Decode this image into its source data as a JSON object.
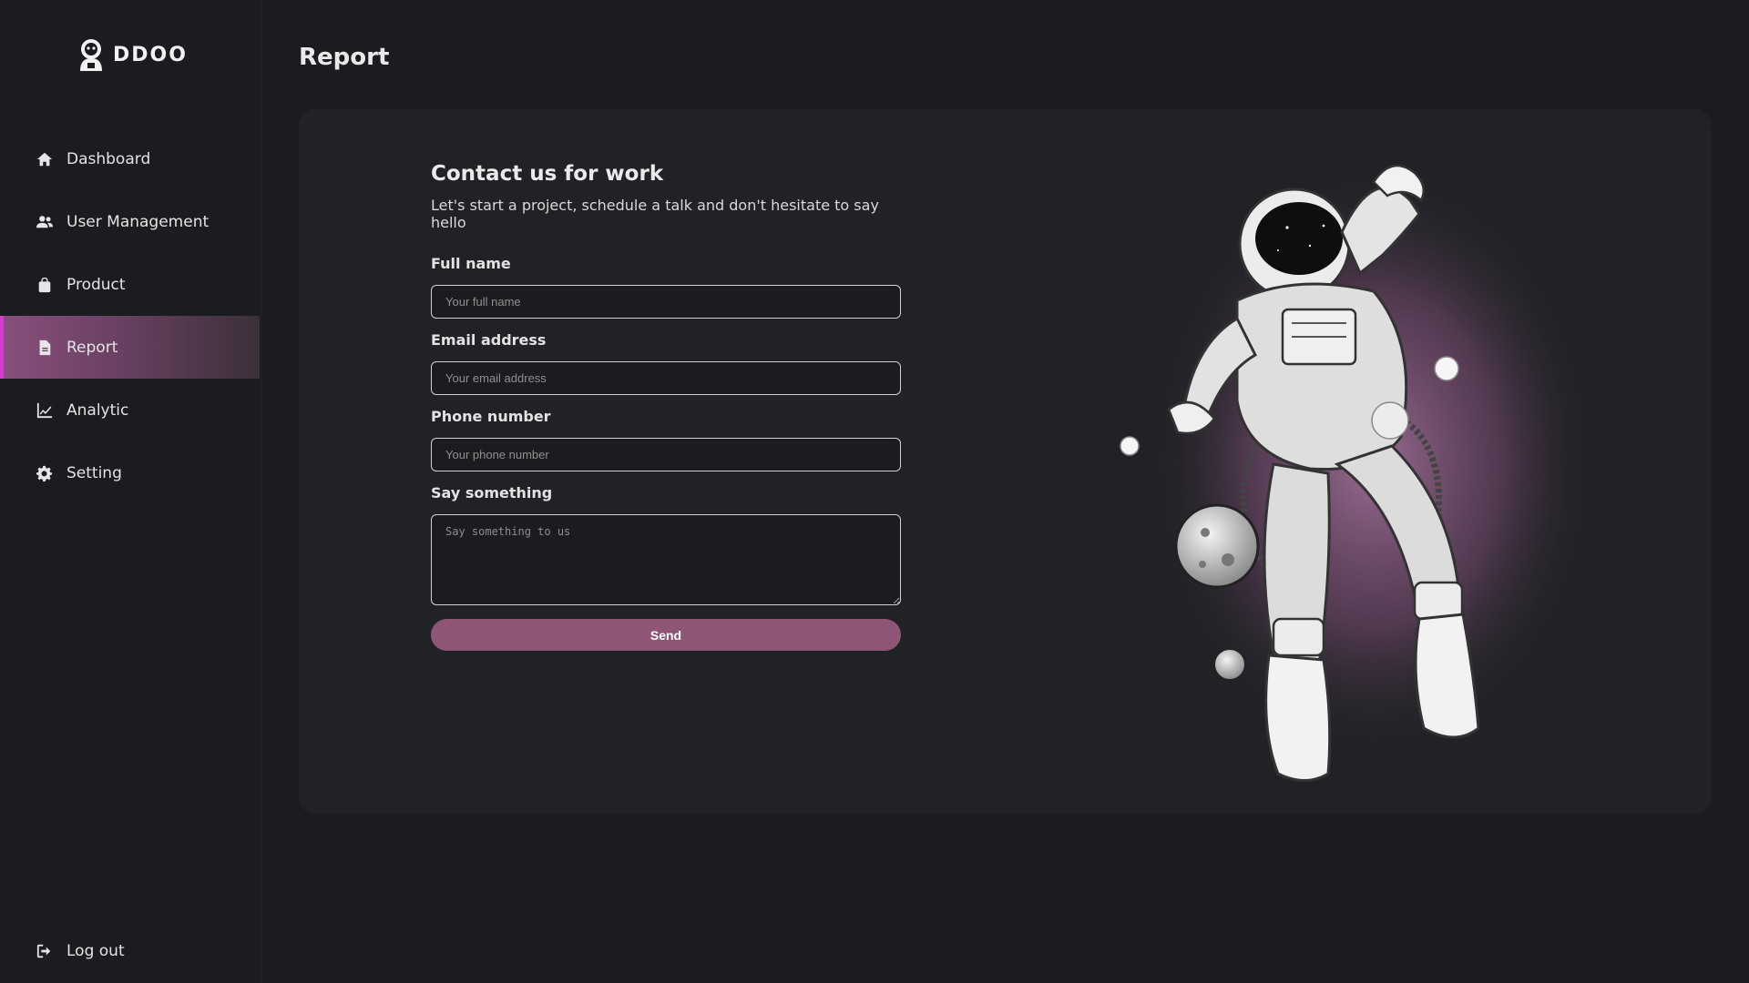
{
  "brand": {
    "name": "DDOO",
    "logo_icon": "astronaut-logo-icon"
  },
  "sidebar": {
    "items": [
      {
        "label": "Dashboard",
        "icon": "home-icon",
        "active": false
      },
      {
        "label": "User Management",
        "icon": "users-icon",
        "active": false
      },
      {
        "label": "Product",
        "icon": "bag-icon",
        "active": false
      },
      {
        "label": "Report",
        "icon": "file-icon",
        "active": true
      },
      {
        "label": "Analytic",
        "icon": "chart-line-icon",
        "active": false
      },
      {
        "label": "Setting",
        "icon": "gear-icon",
        "active": false
      }
    ],
    "logout": {
      "label": "Log out",
      "icon": "logout-icon"
    },
    "active_color": "#d63bd0"
  },
  "page": {
    "title": "Report"
  },
  "form": {
    "heading": "Contact us for work",
    "subheading": "Let's start a project, schedule a talk and don't hesitate to say hello",
    "full_name": {
      "label": "Full name",
      "placeholder": "Your full name",
      "value": ""
    },
    "email": {
      "label": "Email address",
      "placeholder": "Your email address",
      "value": ""
    },
    "phone": {
      "label": "Phone number",
      "placeholder": "Your phone number",
      "value": ""
    },
    "message": {
      "label": "Say something",
      "placeholder": "Say something to us",
      "value": ""
    },
    "send_label": "Send",
    "send_color": "#8f5577"
  },
  "colors": {
    "background": "#1b1c1f",
    "card": "#212226",
    "accent": "#8f5577"
  }
}
